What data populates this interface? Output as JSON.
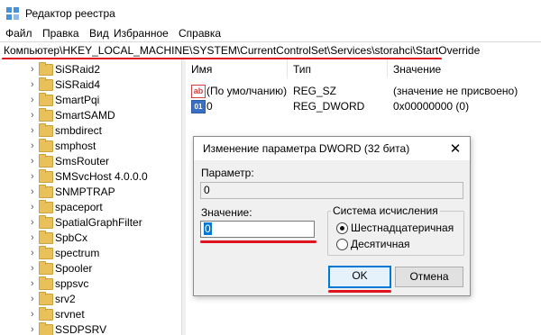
{
  "window": {
    "title": "Редактор реестра"
  },
  "menu": [
    "Файл",
    "Правка",
    "Вид",
    "Избранное",
    "Справка"
  ],
  "address": {
    "path": "Компьютер\\HKEY_LOCAL_MACHINE\\SYSTEM\\CurrentControlSet\\Services\\storahci\\StartOverride"
  },
  "tree": {
    "items": [
      "SiSRaid2",
      "SiSRaid4",
      "SmartPqi",
      "SmartSAMD",
      "smbdirect",
      "smphost",
      "SmsRouter",
      "SMSvcHost 4.0.0.0",
      "SNMPTRAP",
      "spaceport",
      "SpatialGraphFilter",
      "SpbCx",
      "spectrum",
      "Spooler",
      "sppsvc",
      "srv2",
      "srvnet",
      "SSDPSRV"
    ]
  },
  "values_pane": {
    "columns": [
      "Имя",
      "Тип",
      "Значение"
    ],
    "rows": [
      {
        "icon": "string-value-icon",
        "name": "(По умолчанию)",
        "type": "REG_SZ",
        "data": "(значение не присвоено)"
      },
      {
        "icon": "dword-value-icon",
        "name": "0",
        "type": "REG_DWORD",
        "data": "0x00000000 (0)"
      }
    ]
  },
  "dialog": {
    "title": "Изменение параметра DWORD (32 бита)",
    "param_label": "Параметр:",
    "param_value": "0",
    "value_label": "Значение:",
    "value_input": "0",
    "base_group": "Система исчисления",
    "radio_hex": "Шестнадцатеричная",
    "radio_dec": "Десятичная",
    "selected_base": "hex",
    "ok": "OK",
    "cancel": "Отмена",
    "close_glyph": "✕"
  },
  "colors": {
    "highlight": "#e0141e",
    "accent": "#0078d7",
    "folder": "#e8c15a"
  }
}
